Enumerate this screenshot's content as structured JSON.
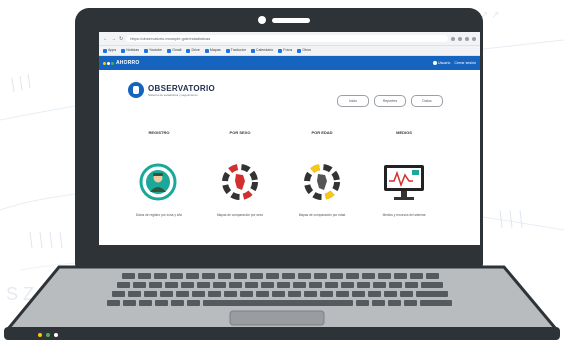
{
  "browser": {
    "url": "https://observatorio.example.gob/estadisticas",
    "bookmarks": [
      "Apps",
      "Noticias",
      "Youtube",
      "Gmail",
      "Drive",
      "Mapas",
      "Traductor",
      "Calendario",
      "Fotos",
      "Otros"
    ]
  },
  "site": {
    "logo": "AHORRO",
    "user_label": "Usuario",
    "logout_label": "Cerrar sesión"
  },
  "page": {
    "brand_title": "OBSERVATORIO",
    "brand_subtitle": "Sistema de estadística y seguimiento",
    "buttons": [
      "Inicio",
      "Reportes",
      "Datos"
    ],
    "cards": [
      {
        "title": "REGISTRO",
        "text": "Datos de registro por zona y año",
        "icon": "person-badge-icon"
      },
      {
        "title": "POR SEXO",
        "text": "Mapas de comparación por sexo",
        "icon": "map-ring-icon"
      },
      {
        "title": "POR EDAD",
        "text": "Mapas de comparación por edad",
        "icon": "map-ring-icon"
      },
      {
        "title": "MEDIOS",
        "text": "Medios y recursos del sistema",
        "icon": "monitor-chart-icon"
      }
    ]
  },
  "colors": {
    "brand": "#1565c0",
    "lid": "#2e3338",
    "keyboard": "#b9bcbf",
    "teal": "#1aa89a"
  }
}
